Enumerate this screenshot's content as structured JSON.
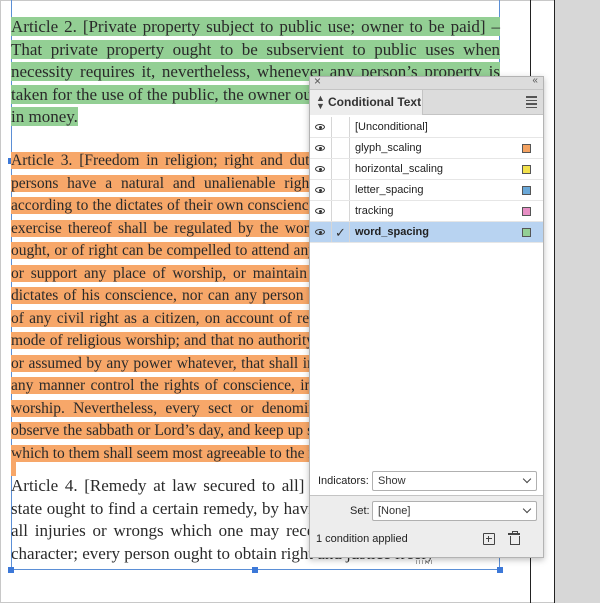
{
  "document": {
    "article2": "Article 2. [Private property subject to public use; owner to be paid] – That private property ought to be subservient to public uses when necessity requires it, nevertheless, whenever any person’s property is taken for the use of the public, the owner ought to receive an equivalent in money.",
    "article3": "Article 3. [Freedom in religion; right and duty of religious worship] – All persons have a natural and unalienable right, to worship Almighty God according to the dictates of their own consciences and understandings; and the exercise thereof shall be regulated by the word of God; and that no person ought, or of right can be compelled to attend any religious worship, or to erect or support any place of worship, or maintain any minister, contrary to the dictates of his conscience, nor can any person be justly deprived or abridged of any civil right as a citizen, on account of religious sentiments, or peculiar mode of religious worship; and that no authority can, or ought to be vested in, or assumed by any power whatever, that shall in any case interfere with, or in any manner control the rights of conscience, in the free exercise of religious worship. Nevertheless, every sect or denomination of christians ought to observe the sabbath or Lord’s day, and keep up some sort of religious worship, which to them shall seem most agreeable to the revealed will of God.",
    "article4": "Article 4. [Remedy at law secured to all] – Every person within this state ought to find a certain remedy, by having recourse to the laws, for all injuries or wrongs which one may receive in person, property, or character; every person ought to obtain right and justice freely"
  },
  "panel": {
    "close_glyph": "×",
    "collapse_glyph": "‹‹",
    "title": "Conditional Text",
    "conditions": [
      {
        "name": "[Unconditional]",
        "visible": true,
        "checked": false,
        "selected": false,
        "color": ""
      },
      {
        "name": "glyph_scaling",
        "visible": true,
        "checked": false,
        "selected": false,
        "color": "#f4a261"
      },
      {
        "name": "horizontal_scaling",
        "visible": true,
        "checked": false,
        "selected": false,
        "color": "#f2e14c"
      },
      {
        "name": "letter_spacing",
        "visible": true,
        "checked": false,
        "selected": false,
        "color": "#6aa8d8"
      },
      {
        "name": "tracking",
        "visible": true,
        "checked": false,
        "selected": false,
        "color": "#e78fc4"
      },
      {
        "name": "word_spacing",
        "visible": true,
        "checked": true,
        "selected": true,
        "color": "#93cf94"
      }
    ],
    "check_glyph": "✓",
    "indicators_label": "Indicators:",
    "indicators_value": "Show",
    "set_label": "Set:",
    "set_value": "[None]",
    "status": "1 condition applied"
  },
  "colors": {
    "green_highlight": "#93cf94",
    "orange_highlight": "#f7a769",
    "selection_blue": "#b8d3f1",
    "frame_blue": "#3c78d8"
  }
}
